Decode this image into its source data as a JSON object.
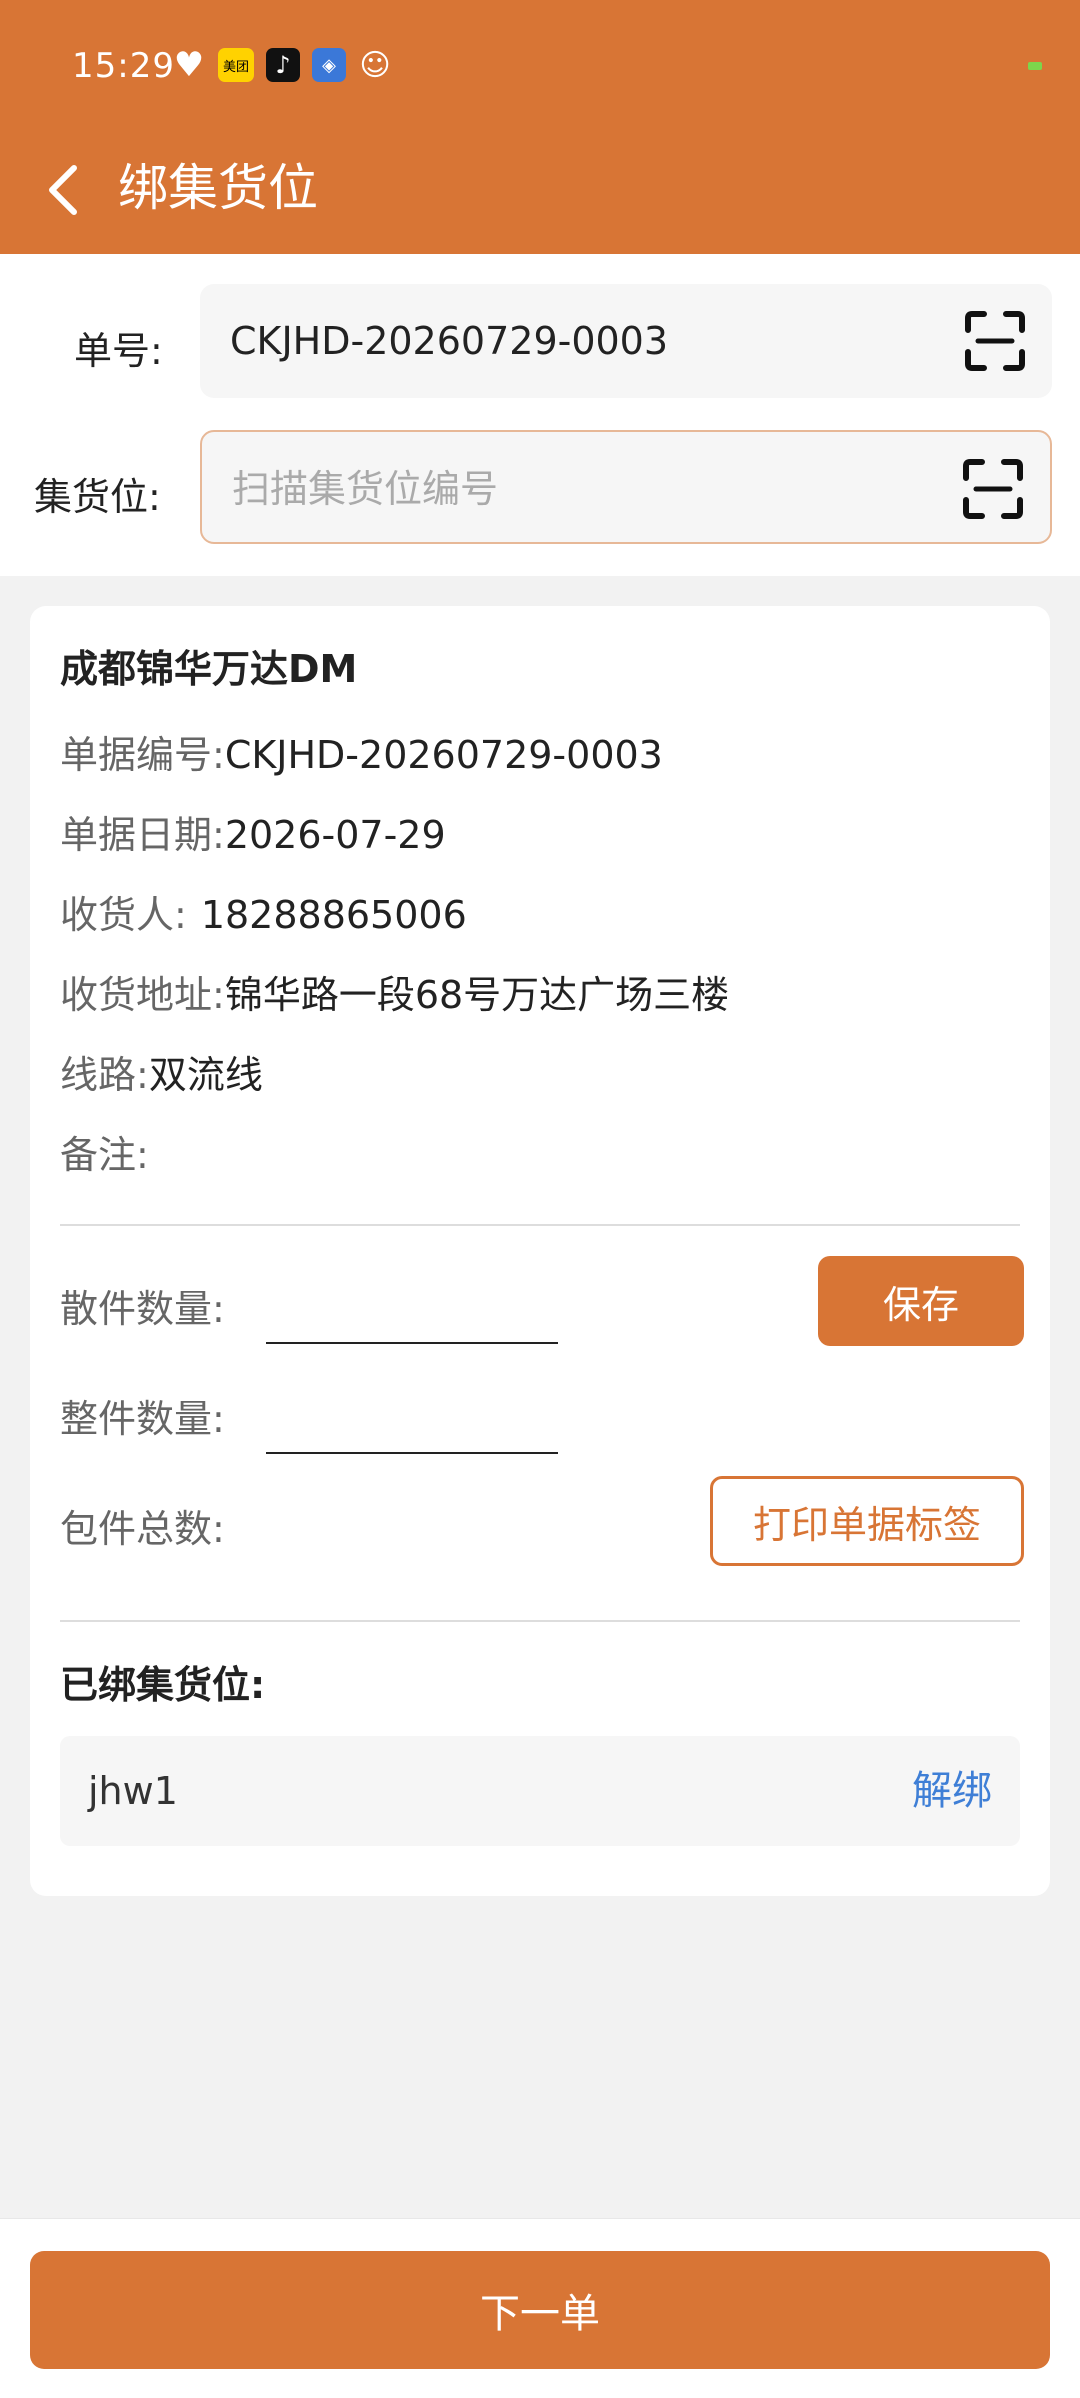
{
  "status_bar": {
    "time": "15:29",
    "meituan": "美团"
  },
  "nav": {
    "title": "绑集货位"
  },
  "form": {
    "order_label": "单号:",
    "order_value": "CKJHD-20260729-0003",
    "slot_label": "集货位:",
    "slot_placeholder": "扫描集货位编号"
  },
  "card": {
    "title": "成都锦华万达DM",
    "fields": [
      {
        "label": "单据编号:",
        "value": "CKJHD-20260729-0003"
      },
      {
        "label": "单据日期:",
        "value": "2026-07-29"
      },
      {
        "label": "收货人:",
        "value": "18288865006"
      },
      {
        "label": "收货地址:",
        "value": "锦华路一段68号万达广场三楼"
      },
      {
        "label": "线路:",
        "value": "双流线"
      },
      {
        "label": "备注:",
        "value": ""
      }
    ],
    "loose_qty_label": "散件数量:",
    "whole_qty_label": "整件数量:",
    "total_label": "包件总数:",
    "save_label": "保存",
    "print_label": "打印单据标签",
    "bound_title": "已绑集货位:",
    "bound_items": [
      {
        "code": "jhw1",
        "action": "解绑"
      }
    ]
  },
  "footer": {
    "next_label": "下一单"
  },
  "colors": {
    "accent": "#d87535",
    "link": "#3f7fd6"
  }
}
